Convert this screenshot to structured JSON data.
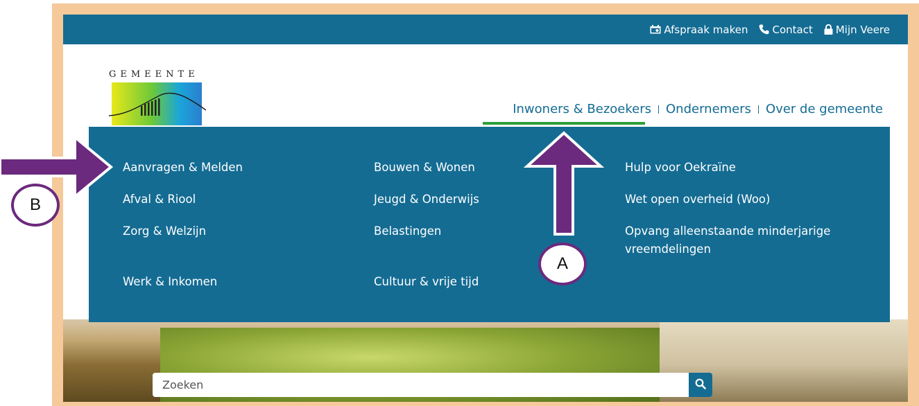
{
  "topbar": {
    "links": [
      {
        "label": "Afspraak maken",
        "icon": "calendar-icon"
      },
      {
        "label": "Contact",
        "icon": "phone-icon"
      },
      {
        "label": "Mijn Veere",
        "icon": "lock-icon"
      }
    ]
  },
  "logo": {
    "text": "GEMEENTE"
  },
  "mainnav": {
    "items": [
      "Inwoners & Bezoekers",
      "Ondernemers",
      "Over de gemeente"
    ],
    "active": "Inwoners & Bezoekers"
  },
  "dropdown": {
    "col1": [
      "Aanvragen & Melden",
      "Afval & Riool",
      "Zorg & Welzijn",
      "Werk & Inkomen"
    ],
    "col2": [
      "Bouwen & Wonen",
      "Jeugd & Onderwijs",
      "Belastingen",
      "Cultuur & vrije tijd"
    ],
    "col3": [
      "Hulp voor Oekraïne",
      "Wet open overheid (Woo)",
      "Opvang alleenstaande minderjarige",
      "vreemdelingen"
    ]
  },
  "search": {
    "placeholder": "Zoeken"
  },
  "annotations": {
    "marker_a": "A",
    "marker_b": "B"
  },
  "colors": {
    "brand_blue": "#146c93",
    "active_green": "#2e9e3b",
    "frame": "#f5c99a",
    "annotation_purple": "#6b2a7d"
  }
}
